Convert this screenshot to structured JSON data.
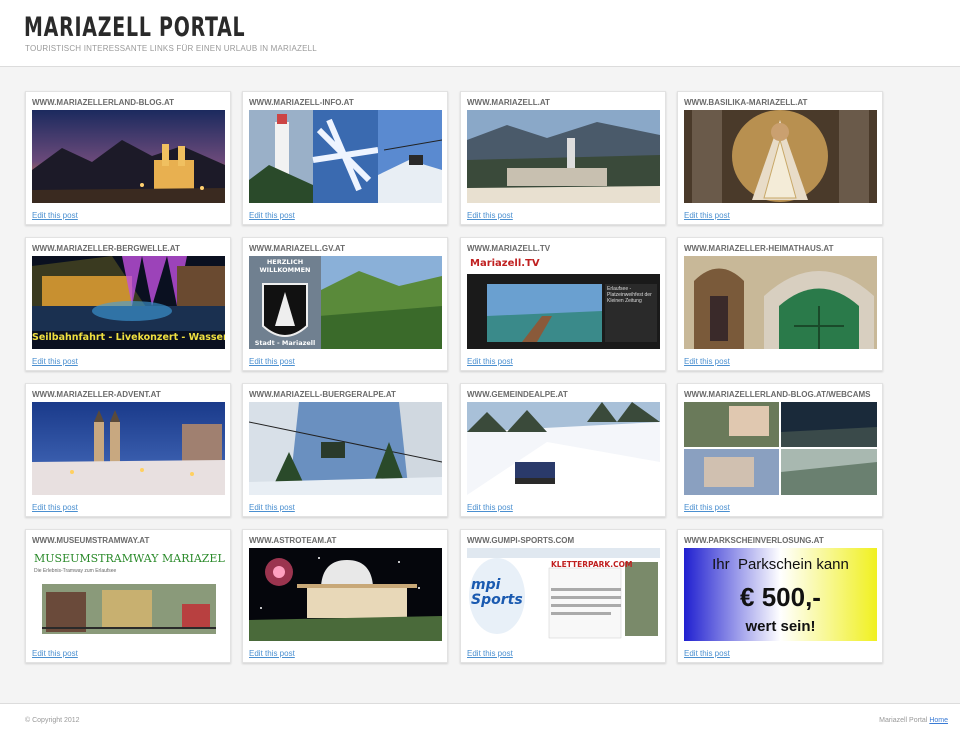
{
  "header": {
    "title": "MARIAZELL PORTAL",
    "tagline": "TOURISTISCH INTERESSANTE LINKS FÜR EINEN URLAUB IN MARIAZELL"
  },
  "posts": [
    {
      "title": "WWW.MARIAZELLERLAND-BLOG.AT",
      "edit": "Edit this post"
    },
    {
      "title": "WWW.MARIAZELL-INFO.AT",
      "edit": "Edit this post"
    },
    {
      "title": "WWW.MARIAZELL.AT",
      "edit": "Edit this post"
    },
    {
      "title": "WWW.BASILIKA-MARIAZELL.AT",
      "edit": "Edit this post"
    },
    {
      "title": "WWW.MARIAZELLER-BERGWELLE.AT",
      "edit": "Edit this post",
      "image_caption": "Seilbahnfahrt - Livekonzert - Wassershow"
    },
    {
      "title": "WWW.MARIAZELL.GV.AT",
      "edit": "Edit this post",
      "image_top": "HERZLICH WILLKOMMEN",
      "image_bottom": "Stadt - Mariazell"
    },
    {
      "title": "WWW.MARIAZELL.TV",
      "edit": "Edit this post",
      "image_logo": "Mariazell.TV",
      "image_text": "Erlaufsee - Platzeinweihfest der Kleinen Zeitung"
    },
    {
      "title": "WWW.MARIAZELLER-HEIMATHAUS.AT",
      "edit": "Edit this post"
    },
    {
      "title": "WWW.MARIAZELLER-ADVENT.AT",
      "edit": "Edit this post"
    },
    {
      "title": "WWW.MARIAZELL-BUERGERALPE.AT",
      "edit": "Edit this post"
    },
    {
      "title": "WWW.GEMEINDEALPE.AT",
      "edit": "Edit this post"
    },
    {
      "title": "WWW.MARIAZELLERLAND-BLOG.AT/WEBCAMS",
      "edit": "Edit this post"
    },
    {
      "title": "WWW.MUSEUMSTRAMWAY.AT",
      "edit": "Edit this post",
      "image_heading": "MUSEUMSTRAMWAY MARIAZELL",
      "image_sub": "Die Erlebnis-Tramway zum Erlaufsee"
    },
    {
      "title": "WWW.ASTROTEAM.AT",
      "edit": "Edit this post"
    },
    {
      "title": "WWW.GUMPI-SPORTS.COM",
      "edit": "Edit this post",
      "image_logo": "KLETTERPARK.COM",
      "image_brand": "mpi Sports"
    },
    {
      "title": "WWW.PARKSCHEINVERLOSUNG.AT",
      "edit": "Edit this post",
      "image_line1": "Ihr  Parkschein kann",
      "image_line2": "€ 500,-",
      "image_line3": "wert sein!"
    }
  ],
  "footer": {
    "copyright": "© Copyright 2012",
    "site_name": "Mariazell Portal",
    "home_link": "Home"
  }
}
